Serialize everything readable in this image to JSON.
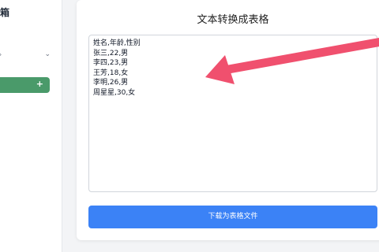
{
  "sidebar": {
    "title": "具箱",
    "section": "单",
    "select_icon": "paint-icon",
    "add_label": "+"
  },
  "main": {
    "title": "文本转换成表格",
    "lines": [
      "姓名,年龄,性别",
      "张三,22,男",
      "李四,23,男",
      "王芳,18,女",
      "李明,26,男",
      "周星星,30,女"
    ],
    "download_label": "下载为表格文件"
  },
  "colors": {
    "button_blue": "#3b82f6",
    "sidebar_green": "#4a9a6a",
    "arrow_red": "#f0506e"
  }
}
